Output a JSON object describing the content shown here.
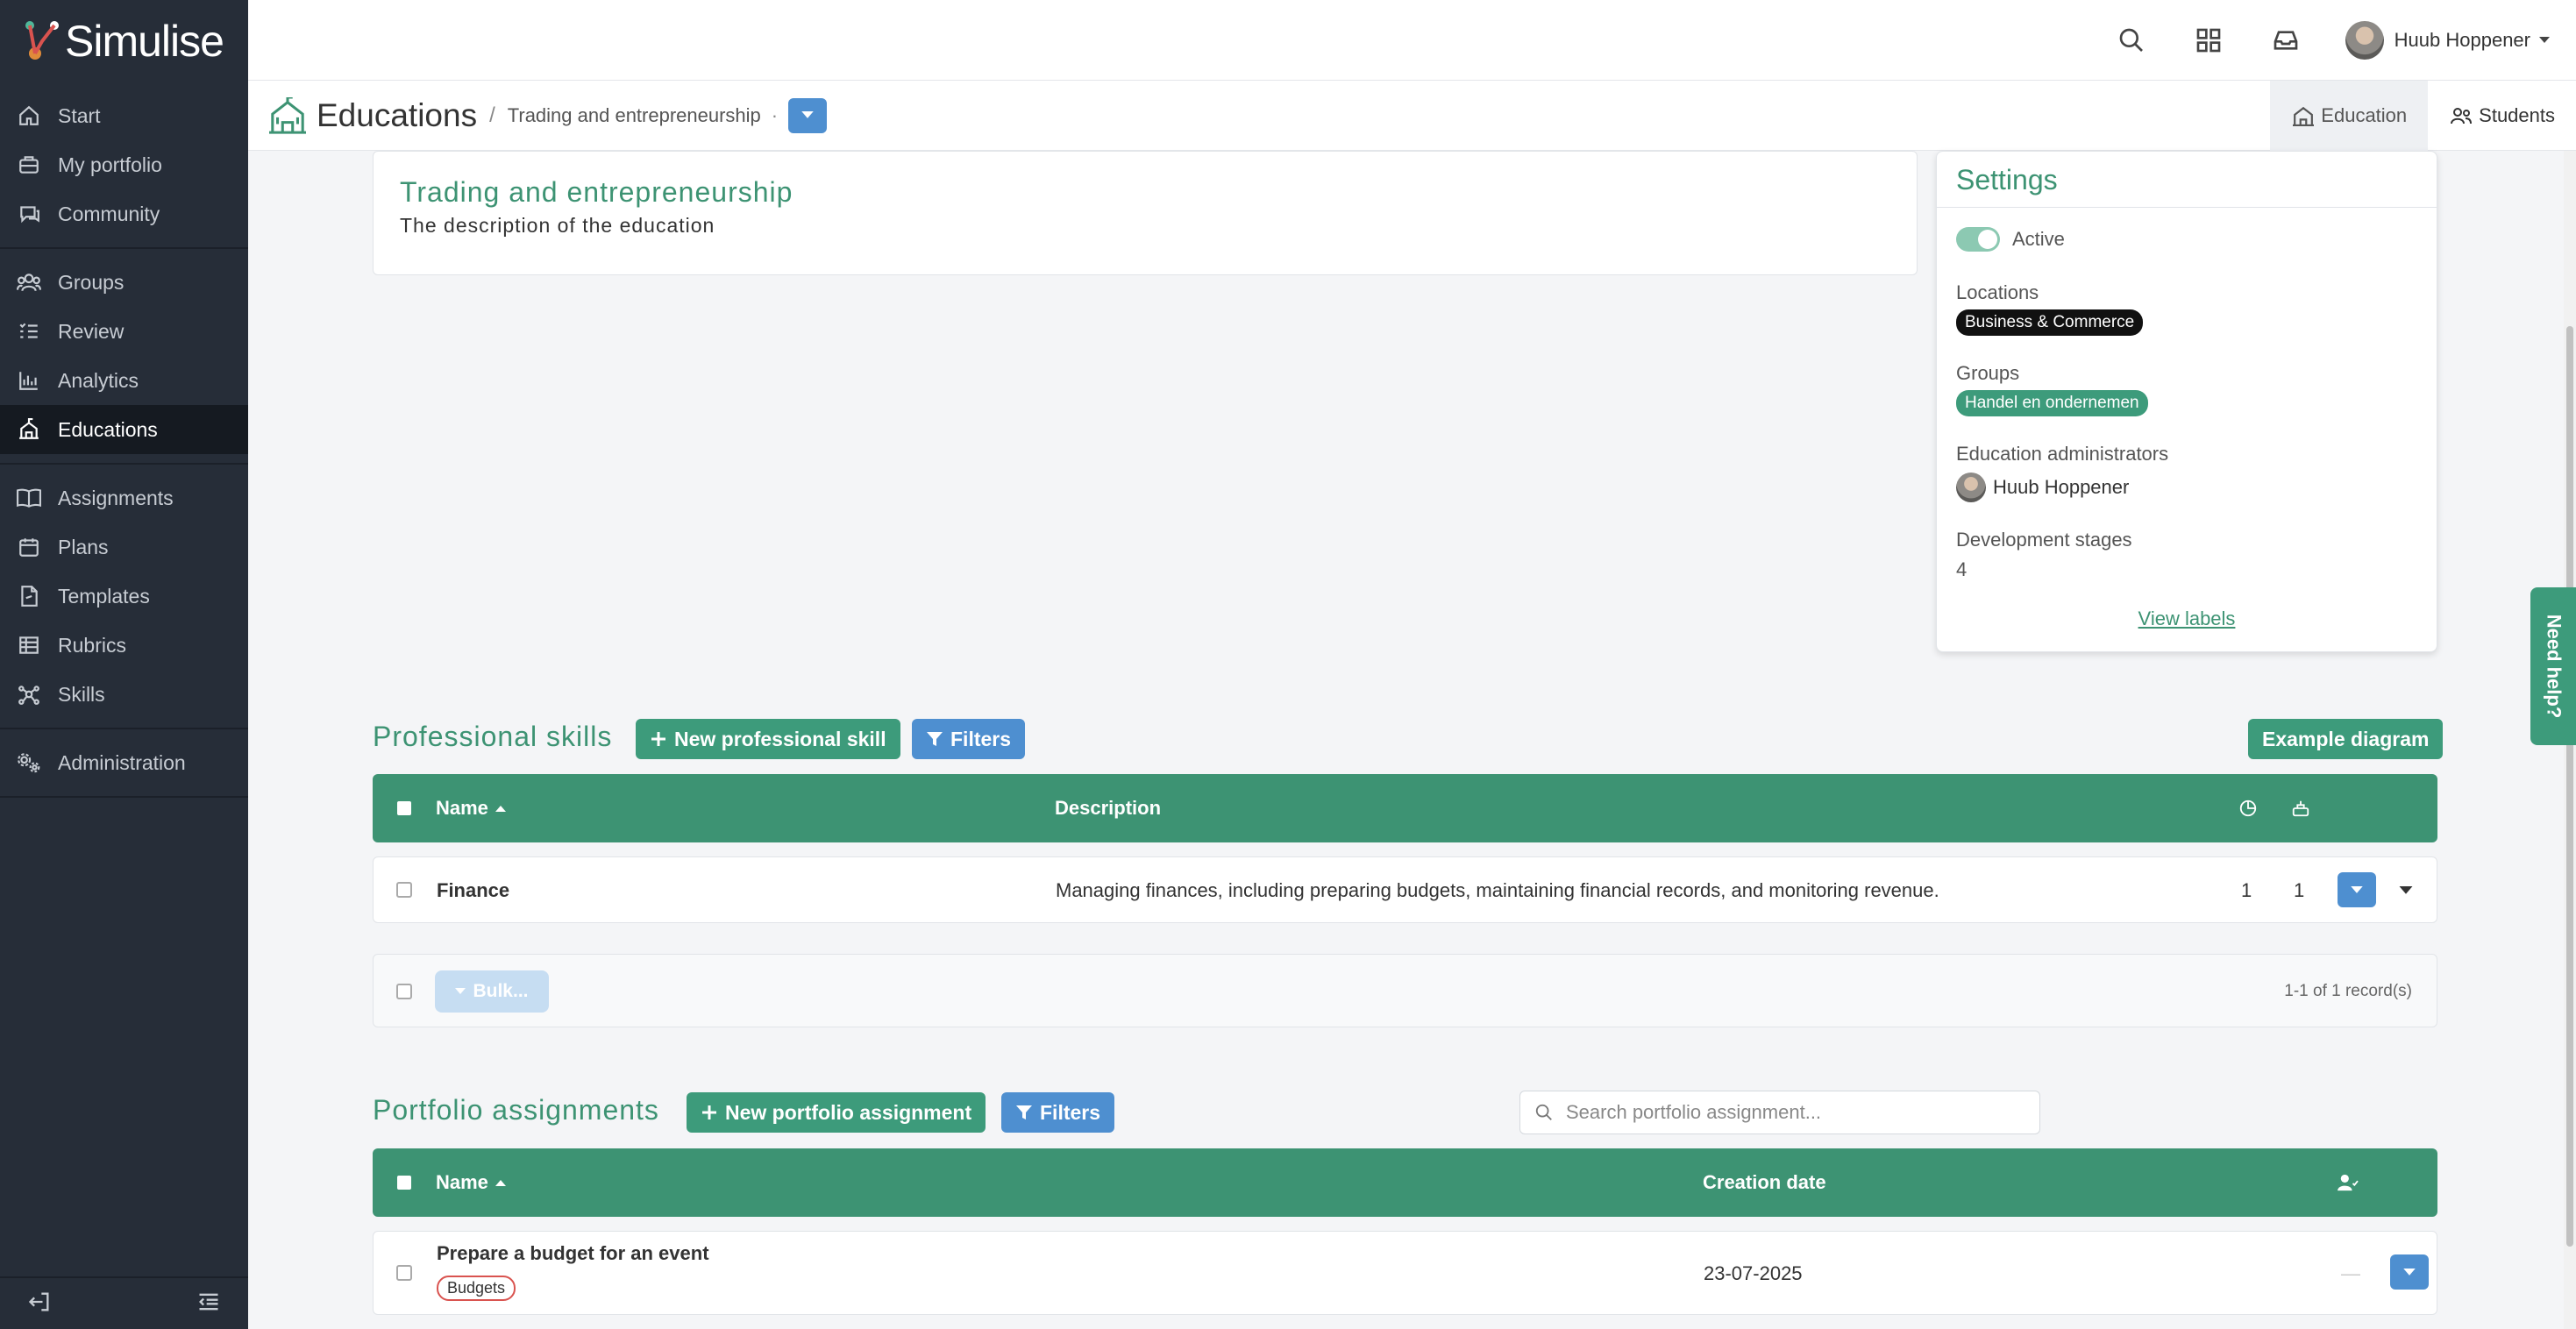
{
  "app": {
    "name": "Simulise"
  },
  "sidebar": {
    "groups": [
      [
        {
          "label": "Start",
          "icon": "home-icon"
        },
        {
          "label": "My portfolio",
          "icon": "briefcase-icon"
        },
        {
          "label": "Community",
          "icon": "chat-icon"
        }
      ],
      [
        {
          "label": "Groups",
          "icon": "users-icon"
        },
        {
          "label": "Review",
          "icon": "checklist-icon"
        },
        {
          "label": "Analytics",
          "icon": "bar-chart-icon"
        },
        {
          "label": "Educations",
          "icon": "school-icon",
          "active": true
        }
      ],
      [
        {
          "label": "Assignments",
          "icon": "book-icon"
        },
        {
          "label": "Plans",
          "icon": "calendar-icon"
        },
        {
          "label": "Templates",
          "icon": "file-icon"
        },
        {
          "label": "Rubrics",
          "icon": "table-icon"
        },
        {
          "label": "Skills",
          "icon": "network-icon"
        }
      ],
      [
        {
          "label": "Administration",
          "icon": "gears-icon"
        }
      ]
    ]
  },
  "topbar": {
    "user_name": "Huub Hoppener"
  },
  "header": {
    "title": "Educations",
    "separator": "/",
    "crumb": "Trading and entrepreneurship",
    "crumb_dot": "·",
    "tabs": [
      {
        "label": "Education",
        "active": true
      },
      {
        "label": "Students"
      }
    ]
  },
  "intro": {
    "title": "Trading and entrepreneurship",
    "description": "The description of the education"
  },
  "settings": {
    "title": "Settings",
    "active_label": "Active",
    "locations_label": "Locations",
    "location": "Business & Commerce",
    "groups_label": "Groups",
    "group": "Handel en ondernemen",
    "admins_label": "Education administrators",
    "admin_name": "Huub Hoppener",
    "stages_label": "Development stages",
    "stages_value": "4",
    "view_labels": "View labels"
  },
  "professional_skills": {
    "title": "Professional skills",
    "new_button": "New professional skill",
    "filters_button": "Filters",
    "example_button": "Example diagram",
    "columns": {
      "name": "Name",
      "description": "Description"
    },
    "rows": [
      {
        "name": "Finance",
        "description": "Managing finances, including preparing budgets, maintaining financial records, and monitoring revenue.",
        "count1": "1",
        "count2": "1"
      }
    ],
    "bulk": "Bulk...",
    "records": "1-1 of 1 record(s)"
  },
  "portfolio_assignments": {
    "title": "Portfolio assignments",
    "new_button": "New portfolio assignment",
    "filters_button": "Filters",
    "search_placeholder": "Search portfolio assignment...",
    "columns": {
      "name": "Name",
      "creation_date": "Creation date"
    },
    "rows": [
      {
        "name": "Prepare a budget for an event",
        "tag": "Budgets",
        "date": "23-07-2025",
        "assignees": "—"
      }
    ]
  },
  "help": {
    "label": "Need help?"
  },
  "colors": {
    "brand_green": "#3d9373",
    "accent_blue": "#4e8fd0",
    "sidebar_bg": "#262d38"
  }
}
